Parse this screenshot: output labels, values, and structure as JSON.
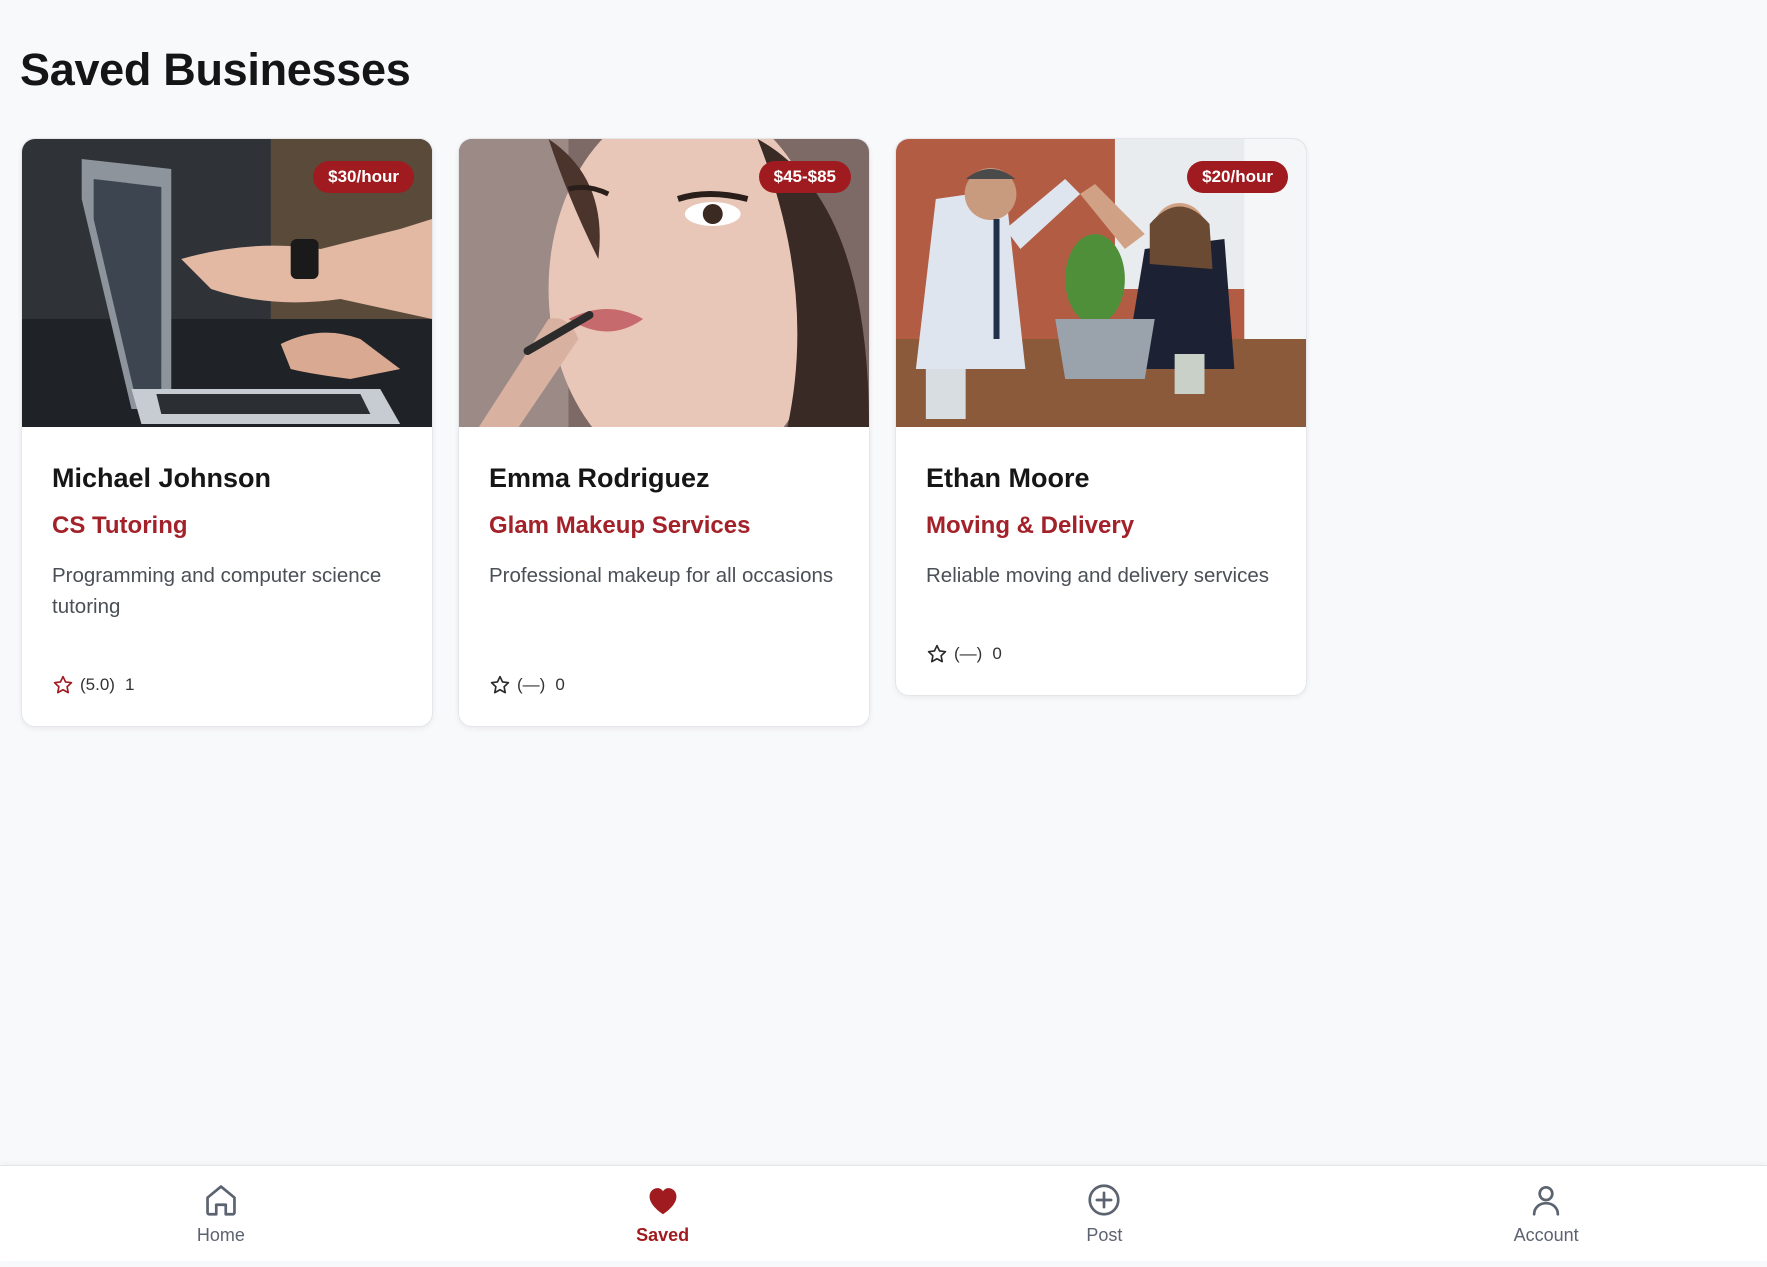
{
  "page": {
    "title": "Saved Businesses"
  },
  "cards": [
    {
      "name": "Michael Johnson",
      "category": "CS Tutoring",
      "description": "Programming and computer science tutoring",
      "price": "$30/hour",
      "rating": "(5.0)",
      "review_count": "1",
      "rated": true
    },
    {
      "name": "Emma Rodriguez",
      "category": "Glam Makeup Services",
      "description": "Professional makeup for all occasions",
      "price": "$45-$85",
      "rating": "(—)",
      "review_count": "0",
      "rated": false
    },
    {
      "name": "Ethan Moore",
      "category": "Moving & Delivery",
      "description": "Reliable moving and delivery services",
      "price": "$20/hour",
      "rating": "(—)",
      "review_count": "0",
      "rated": false
    }
  ],
  "nav": {
    "items": [
      {
        "label": "Home",
        "icon": "home-icon",
        "active": false
      },
      {
        "label": "Saved",
        "icon": "heart-icon",
        "active": true
      },
      {
        "label": "Post",
        "icon": "plus-circle-icon",
        "active": false
      },
      {
        "label": "Account",
        "icon": "user-icon",
        "active": false
      }
    ]
  },
  "colors": {
    "accent": "#a01b1f",
    "background": "#f8f9fb",
    "muted_text": "#5b6270"
  }
}
